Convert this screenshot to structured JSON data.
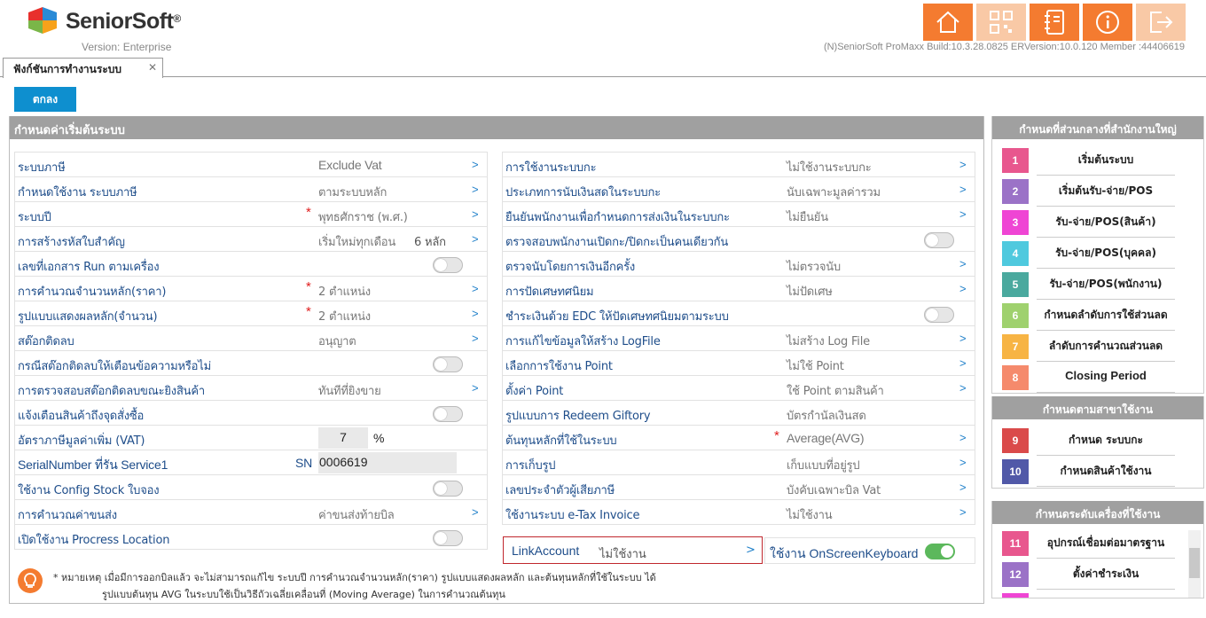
{
  "header": {
    "brand": "SeniorSoft",
    "brand_mark": "®",
    "version": "Version: Enterprise",
    "build_info": "(N)SeniorSoft ProMaxx Build:10.3.28.0825 ERVersion:10.0.120 Member :44406619",
    "brand_colors": [
      "#e8302c",
      "#2a8ad6",
      "#7ab648",
      "#f7a21b"
    ],
    "accent": "#f47b30",
    "toolbar_icons": [
      "home-icon",
      "qr-code-icon",
      "notebook-icon",
      "info-icon",
      "logout-icon"
    ]
  },
  "tab": {
    "label": "ฟังก์ชันการทำงานระบบ",
    "close": "✕"
  },
  "ok_button": "ตกลง",
  "main_panel": {
    "title": "กำหนดค่าเริ่มต้นระบบ"
  },
  "left_rows": [
    {
      "label": "ระบบภาษี",
      "value": "Exclude Vat",
      "value_en": true,
      "type": "select"
    },
    {
      "label": "กำหนดใช้งาน ระบบภาษี",
      "value": "ตามระบบหลัก",
      "type": "select"
    },
    {
      "label": "ระบบปี",
      "value": "พุทธศักราช (พ.ศ.)",
      "required": "*",
      "type": "select"
    },
    {
      "label": "การสร้างรหัสใบสำคัญ",
      "value": "เริ่มใหม่ทุกเดือน",
      "extra": "6 หลัก",
      "type": "select"
    },
    {
      "label": "เลขที่เอกสาร Run ตามเครื่อง",
      "type": "toggle",
      "on": false
    },
    {
      "label": "การคำนวณจำนวนหลัก(ราคา)",
      "value": "2 ตำแหน่ง",
      "required": "*",
      "type": "select"
    },
    {
      "label": "รูปแบบแสดงผลหลัก(จำนวน)",
      "value": "2 ตำแหน่ง",
      "required": "*",
      "type": "select"
    },
    {
      "label": "สต๊อกติดลบ",
      "value": "อนุญาต",
      "type": "select"
    },
    {
      "label": "กรณีสต๊อกติดลบให้เตือนข้อความหรือไม่",
      "type": "toggle",
      "on": false
    },
    {
      "label": "การตรวจสอบสต๊อกติดลบขณะยิงสินค้า",
      "value": "ทันทีที่ยิงขาย",
      "type": "select"
    },
    {
      "label": "แจ้งเตือนสินค้าถึงจุดสั่งซื้อ",
      "type": "toggle",
      "on": false
    },
    {
      "label": "อัตราภาษีมูลค่าเพิ่ม (VAT)",
      "value": "7",
      "unit": "%",
      "type": "input"
    },
    {
      "label": "SerialNumber ที่รัน Service1",
      "prefix": "SN",
      "value": "0006619",
      "type": "input-wide"
    },
    {
      "label": "ใช้งาน Config Stock ใบจอง",
      "type": "toggle",
      "on": false
    },
    {
      "label": "การคำนวณค่าขนส่ง",
      "value": "ค่าขนส่งท้ายบิล",
      "type": "select"
    },
    {
      "label": "เปิดใช้งาน Procress Location",
      "type": "toggle",
      "on": false
    }
  ],
  "right_rows": [
    {
      "label": "การใช้งานระบบกะ",
      "value": "ไม่ใช้งานระบบกะ",
      "type": "select"
    },
    {
      "label": "ประเภทการนับเงินสดในระบบกะ",
      "value": "นับเฉพาะมูลค่ารวม",
      "type": "select"
    },
    {
      "label": "ยืนยันพนักงานเพื่อกำหนดการส่งเงินในระบบกะ",
      "value": "ไม่ยืนยัน",
      "type": "select"
    },
    {
      "label": "ตรวจสอบพนักงานเปิดกะ/ปิดกะเป็นคนเดียวกัน",
      "type": "toggle",
      "on": false
    },
    {
      "label": "ตรวจนับโดยการเงินอีกครั้ง",
      "value": "ไม่ตรวจนับ",
      "type": "select"
    },
    {
      "label": "การปัดเศษทศนิยม",
      "value": "ไม่ปัดเศษ",
      "type": "select"
    },
    {
      "label": "ชำระเงินด้วย EDC ให้ปัดเศษทศนิยมตามระบบ",
      "type": "toggle",
      "on": false
    },
    {
      "label": "การแก้ไขข้อมูลให้สร้าง LogFile",
      "value": "ไม่สร้าง Log File",
      "type": "select"
    },
    {
      "label": "เลือกการใช้งาน Point",
      "value": "ไม่ใช้ Point",
      "type": "select"
    },
    {
      "label": "ตั้งค่า Point",
      "value": "ใช้ Point ตามสินค้า",
      "type": "select"
    },
    {
      "label": "รูปแบบการ Redeem Giftory",
      "value": "บัตรกำนัลเงินสด",
      "type": "plain"
    },
    {
      "label": "ต้นทุนหลักที่ใช้ในระบบ",
      "value": "Average(AVG)",
      "value_en": true,
      "required": "*",
      "type": "select"
    },
    {
      "label": "การเก็บรูป",
      "value": "เก็บแบบที่อยู่รูป",
      "type": "select"
    },
    {
      "label": "เลขประจำตัวผู้เสียภาษี",
      "value": "บังคับเฉพาะบิล Vat",
      "type": "select"
    },
    {
      "label": "ใช้งานระบบ e-Tax Invoice",
      "value": "ไม่ใช้งาน",
      "type": "select"
    }
  ],
  "link_account": {
    "label": "LinkAccount",
    "value": "ไม่ใช้งาน"
  },
  "onscreen_keyboard": {
    "label": "ใช้งาน OnScreenKeyboard",
    "on": true
  },
  "note": {
    "line1": "* หมายเหตุ เมื่อมีการออกบิลแล้ว จะไม่สามารถแก้ไข ระบบปี การคำนวณจำนวนหลัก(ราคา) รูปแบบแสดงผลหลัก และต้นทุนหลักที่ใช้ในระบบ ได้",
    "line2": "รูปแบบต้นทุน AVG ในระบบใช้เป็นวิธีถัวเฉลี่ยเคลื่อนที่ (Moving Average) ในการคำนวณต้นทุน"
  },
  "side_central": {
    "title": "กำหนดที่ส่วนกลางที่สำนักงานใหญ่",
    "items": [
      {
        "num": "1",
        "label": "เริ่มต้นระบบ",
        "color": "#e8578e"
      },
      {
        "num": "2",
        "label": "เริ่มต้นรับ-จ่าย/POS",
        "color": "#9b72c7"
      },
      {
        "num": "3",
        "label": "รับ-จ่าย/POS(สินค้า)",
        "color": "#ef45d4"
      },
      {
        "num": "4",
        "label": "รับ-จ่าย/POS(บุคคล)",
        "color": "#4fc9de"
      },
      {
        "num": "5",
        "label": "รับ-จ่าย/POS(พนักงาน)",
        "color": "#4aa99e"
      },
      {
        "num": "6",
        "label": "กำหนดลำดับการใช้ส่วนลด",
        "color": "#9fd16e"
      },
      {
        "num": "7",
        "label": "ลำดับการคำนวณส่วนลด",
        "color": "#f7b444"
      },
      {
        "num": "8",
        "label": "Closing Period",
        "color": "#f58a6c",
        "en": true
      }
    ]
  },
  "side_branch": {
    "title": "กำหนดตามสาขาใช้งาน",
    "items": [
      {
        "num": "9",
        "label": "กำหนด ระบบกะ",
        "color": "#da4a4a"
      },
      {
        "num": "10",
        "label": "กำหนดสินค้าใช้งาน",
        "color": "#5159a8"
      }
    ]
  },
  "side_machine": {
    "title": "กำหนดระดับเครื่องที่ใช้งาน",
    "items": [
      {
        "num": "11",
        "label": "อุปกรณ์เชื่อมต่อมาตรฐาน",
        "color": "#e8578e"
      },
      {
        "num": "12",
        "label": "ตั้งค่าชำระเงิน",
        "color": "#9b72c7"
      },
      {
        "num": "",
        "label": "",
        "color": "#ef45d4"
      }
    ]
  }
}
